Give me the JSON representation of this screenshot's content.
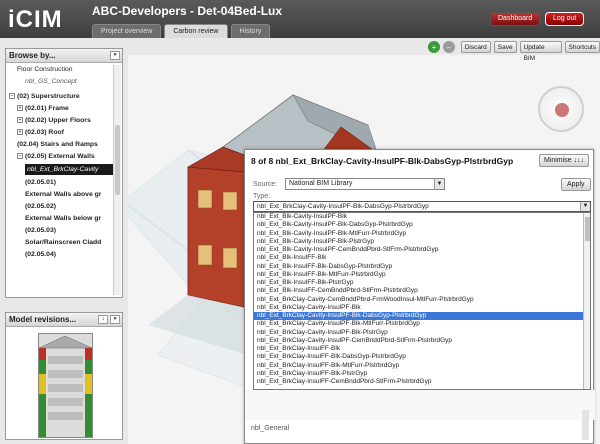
{
  "app": {
    "logo": "iCIM",
    "title": "ABC-Developers - Det-04Bed-Lux"
  },
  "header": {
    "dashboard_label": "Dashboard",
    "logout_label": "Log out"
  },
  "tabs": [
    {
      "label": "Project overview",
      "active": false
    },
    {
      "label": "Carbon review",
      "active": true
    },
    {
      "label": "History",
      "active": false
    }
  ],
  "toolbar": {
    "discard_label": "Discard",
    "save_label": "Save",
    "update_bim_label": "Update BIM",
    "shortcuts_label": "Shortcuts"
  },
  "browse": {
    "title": "Browse by...",
    "close_icon": "»",
    "items": [
      "Floor Construction",
      "nbl_GS_Concept",
      "(02) Superstructure",
      "(02.01) Frame",
      "(02.02) Upper Floors",
      "(02.03) Roof",
      "(02.04) Stairs and Ramps",
      "(02.05) External Walls",
      "nbl_Ext_BrkClay-Cavity",
      "(02.05.01)",
      "External Walls above gr",
      "(02.05.02)",
      "External Walls below gr",
      "(02.05.03)",
      "Solar/Rainscreen Cladd",
      "(02.05.04)"
    ]
  },
  "revisions": {
    "title": "Model revisions...",
    "down_icon": "↓",
    "close_icon": "»"
  },
  "modal": {
    "title": "8 of 8 nbl_Ext_BrkClay-Cavity-InsulPF-Blk-DabsGyp-PlstrbrdGyp",
    "minimise_label": "Minimise ↓↓↓",
    "source_label": "Source:",
    "source_value": "National BIM Library",
    "apply_label": "Apply",
    "type_label": "Type:",
    "type_value": "nbl_Ext_BrkClay-Cavity-InsulPF-Blk-DabsGyp-PlstrbrdGyp",
    "options": [
      "nbl_Ext_Blk-Cavity-InsulPF-Blk",
      "nbl_Ext_Blk-Cavity-InsulPF-Blk-DabsGyp-PlstrbrdGyp",
      "nbl_Ext_Blk-Cavity-InsulPF-Blk-MtlFurr-PlstrbrdGyp",
      "nbl_Ext_Blk-Cavity-InsulPF-Blk-PlstrGyp",
      "nbl_Ext_Blk-Cavity-InsulPF-CemBnddPbrd-StlFrm-PlstrbrdGyp",
      "nbl_Ext_Blk-InsulFF-Blk",
      "nbl_Ext_Blk-InsulFF-Blk-DabsGyp-PlstrbrdGyp",
      "nbl_Ext_Blk-InsulFF-Blk-MtlFurr-PlstrbrdGyp",
      "nbl_Ext_Blk-InsulFF-Blk-PlstrGyp",
      "nbl_Ext_Blk-InsulFF-CemBnddPbrd-StlFrm-PlstrbrdGyp",
      "nbl_Ext_BrkClay-Cavity-CemBnddPbrd-FrmWoodInsul-MtlFurr-PlstrbrdGyp",
      "nbl_Ext_BrkClay-Cavity-InsulPF-Blk",
      "nbl_Ext_BrkClay-Cavity-InsulPF-Blk-DabsGyp-PlstrbrdGyp",
      "nbl_Ext_BrkClay-Cavity-InsulPF-Blk-MtlFurr-PlstrbrdGyp",
      "nbl_Ext_BrkClay-Cavity-InsulPF-Blk-PlstrGyp",
      "nbl_Ext_BrkClay-Cavity-InsulPF-CemBnddPbrd-StlFrm-PlstrbrdGyp",
      "nbl_Ext_BrkClay-InsulFF-Blk",
      "nbl_Ext_BrkClay-InsulFF-Blk-DabsGyp-PlstrbrdGyp",
      "nbl_Ext_BrkClay-InsulFF-Blk-MtlFurr-PlstrbrdGyp",
      "nbl_Ext_BrkClay-InsulFF-Blk-PlstrGyp",
      "nbl_Ext_BrkClay-InsulFF-CemBnddPbrd-StlFrm-PlstrbrdGyp"
    ],
    "selected_index": 12,
    "bottom_label": "nbl_General"
  },
  "colors": {
    "brick": "#b5402a",
    "brand_red": "#a01818",
    "highlight": "#3c78d8"
  }
}
